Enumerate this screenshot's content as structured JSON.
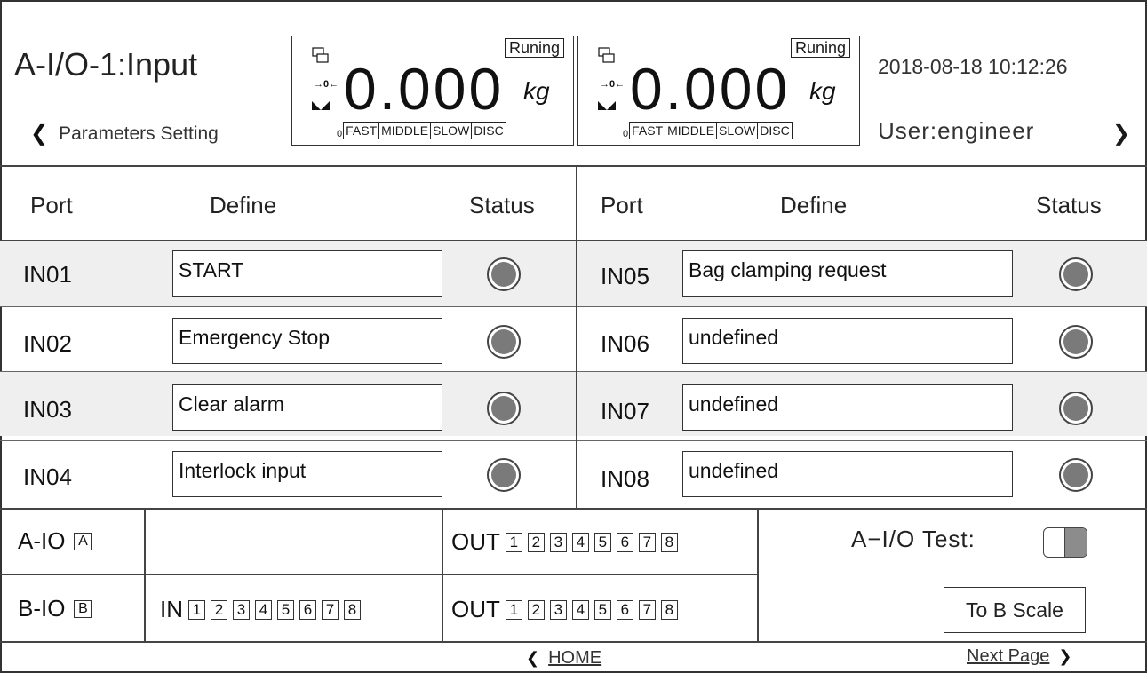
{
  "header": {
    "title": "A-I/O-1:Input",
    "back_label": "Parameters Setting",
    "datetime": "2018-08-18 10:12:26",
    "user": "User:engineer"
  },
  "scales": [
    {
      "weight": "0.000",
      "unit": "kg",
      "status": "Runing",
      "zero_mark": "→0←",
      "speed_zero": "0",
      "speeds": [
        "FAST",
        "MIDDLE",
        "SLOW",
        "DISC"
      ]
    },
    {
      "weight": "0.000",
      "unit": "kg",
      "status": "Runing",
      "zero_mark": "→0←",
      "speed_zero": "0",
      "speeds": [
        "FAST",
        "MIDDLE",
        "SLOW",
        "DISC"
      ]
    }
  ],
  "table": {
    "headers": {
      "port": "Port",
      "define": "Define",
      "status": "Status"
    },
    "left": [
      {
        "port": "IN01",
        "define": "START"
      },
      {
        "port": "IN02",
        "define": "Emergency Stop"
      },
      {
        "port": "IN03",
        "define": "Clear alarm"
      },
      {
        "port": "IN04",
        "define": "Interlock input"
      }
    ],
    "right": [
      {
        "port": "IN05",
        "define": "Bag clamping request"
      },
      {
        "port": "IN06",
        "define": "undefined"
      },
      {
        "port": "IN07",
        "define": "undefined"
      },
      {
        "port": "IN08",
        "define": "undefined"
      }
    ]
  },
  "io_panel": {
    "a_label": "A-IO",
    "a_tag": "A",
    "b_label": "B-IO",
    "b_tag": "B",
    "in_label": "IN",
    "out_label": "OUT",
    "numbers": [
      "1",
      "2",
      "3",
      "4",
      "5",
      "6",
      "7",
      "8"
    ],
    "test_label": "A−I/O Test:",
    "test_on": true,
    "to_b_scale": "To B Scale"
  },
  "footer": {
    "home": "HOME",
    "next": "Next Page"
  },
  "colors": {
    "led": "#7a7a7a",
    "row_shade": "#efefef",
    "border": "#333333"
  }
}
